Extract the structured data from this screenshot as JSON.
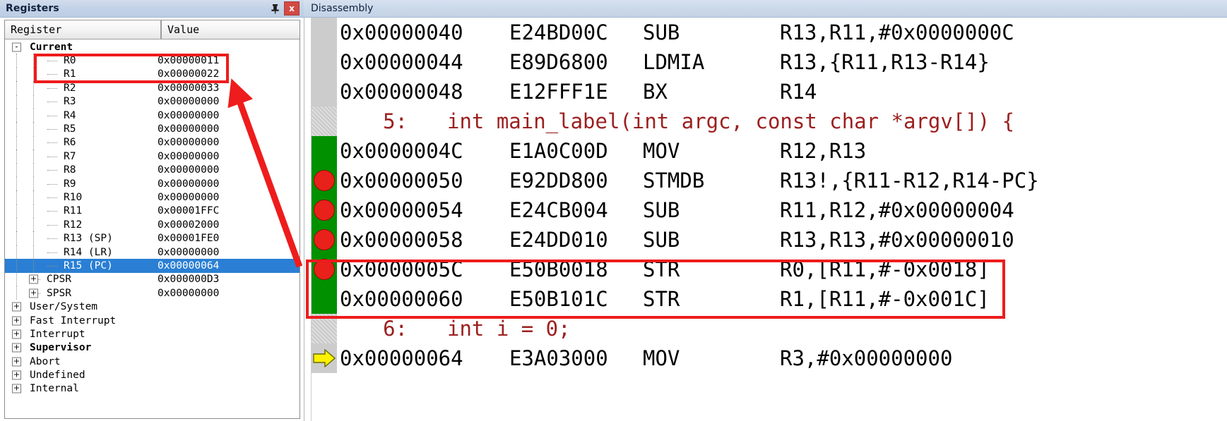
{
  "registers_panel": {
    "title": "Registers",
    "pin_icon": "pin-icon",
    "close_label": "x",
    "columns": {
      "name": "Register",
      "value": "Value"
    },
    "rows": [
      {
        "label": "Current",
        "value": "",
        "level": 0,
        "expander": "-",
        "bold": true,
        "selected": false
      },
      {
        "label": "R0",
        "value": "0x00000011",
        "level": 2,
        "expander": "",
        "bold": false,
        "selected": false
      },
      {
        "label": "R1",
        "value": "0x00000022",
        "level": 2,
        "expander": "",
        "bold": false,
        "selected": false
      },
      {
        "label": "R2",
        "value": "0x00000033",
        "level": 2,
        "expander": "",
        "bold": false,
        "selected": false
      },
      {
        "label": "R3",
        "value": "0x00000000",
        "level": 2,
        "expander": "",
        "bold": false,
        "selected": false
      },
      {
        "label": "R4",
        "value": "0x00000000",
        "level": 2,
        "expander": "",
        "bold": false,
        "selected": false
      },
      {
        "label": "R5",
        "value": "0x00000000",
        "level": 2,
        "expander": "",
        "bold": false,
        "selected": false
      },
      {
        "label": "R6",
        "value": "0x00000000",
        "level": 2,
        "expander": "",
        "bold": false,
        "selected": false
      },
      {
        "label": "R7",
        "value": "0x00000000",
        "level": 2,
        "expander": "",
        "bold": false,
        "selected": false
      },
      {
        "label": "R8",
        "value": "0x00000000",
        "level": 2,
        "expander": "",
        "bold": false,
        "selected": false
      },
      {
        "label": "R9",
        "value": "0x00000000",
        "level": 2,
        "expander": "",
        "bold": false,
        "selected": false
      },
      {
        "label": "R10",
        "value": "0x00000000",
        "level": 2,
        "expander": "",
        "bold": false,
        "selected": false
      },
      {
        "label": "R11",
        "value": "0x00001FFC",
        "level": 2,
        "expander": "",
        "bold": false,
        "selected": false
      },
      {
        "label": "R12",
        "value": "0x00002000",
        "level": 2,
        "expander": "",
        "bold": false,
        "selected": false
      },
      {
        "label": "R13 (SP)",
        "value": "0x00001FE0",
        "level": 2,
        "expander": "",
        "bold": false,
        "selected": false
      },
      {
        "label": "R14 (LR)",
        "value": "0x00000000",
        "level": 2,
        "expander": "",
        "bold": false,
        "selected": false
      },
      {
        "label": "R15 (PC)",
        "value": "0x00000064",
        "level": 2,
        "expander": "",
        "bold": false,
        "selected": true
      },
      {
        "label": "CPSR",
        "value": "0x000000D3",
        "level": 1,
        "expander": "+",
        "bold": false,
        "selected": false
      },
      {
        "label": "SPSR",
        "value": "0x00000000",
        "level": 1,
        "expander": "+",
        "bold": false,
        "selected": false
      },
      {
        "label": "User/System",
        "value": "",
        "level": 0,
        "expander": "+",
        "bold": false,
        "selected": false
      },
      {
        "label": "Fast Interrupt",
        "value": "",
        "level": 0,
        "expander": "+",
        "bold": false,
        "selected": false
      },
      {
        "label": "Interrupt",
        "value": "",
        "level": 0,
        "expander": "+",
        "bold": false,
        "selected": false
      },
      {
        "label": "Supervisor",
        "value": "",
        "level": 0,
        "expander": "+",
        "bold": true,
        "selected": false
      },
      {
        "label": "Abort",
        "value": "",
        "level": 0,
        "expander": "+",
        "bold": false,
        "selected": false
      },
      {
        "label": "Undefined",
        "value": "",
        "level": 0,
        "expander": "+",
        "bold": false,
        "selected": false
      },
      {
        "label": "Internal",
        "value": "",
        "level": 0,
        "expander": "+",
        "bold": false,
        "selected": false
      }
    ]
  },
  "disassembly_panel": {
    "title": "Disassembly",
    "rows": [
      {
        "kind": "code",
        "gutter": "plain",
        "marker": "none",
        "address": "0x00000040",
        "opcode": "E24BD00C",
        "mnemonic": "SUB",
        "operands": "R13,R11,#0x0000000C"
      },
      {
        "kind": "code",
        "gutter": "plain",
        "marker": "none",
        "address": "0x00000044",
        "opcode": "E89D6800",
        "mnemonic": "LDMIA",
        "operands": "R13,{R11,R13-R14}"
      },
      {
        "kind": "code",
        "gutter": "plain",
        "marker": "none",
        "address": "0x00000048",
        "opcode": "E12FFF1E",
        "mnemonic": "BX",
        "operands": "R14"
      },
      {
        "kind": "source",
        "gutter": "hatch",
        "line_number": "5:",
        "text": "int main_label(int argc, const char *argv[]) {"
      },
      {
        "kind": "code",
        "gutter": "green",
        "marker": "none",
        "address": "0x0000004C",
        "opcode": "E1A0C00D",
        "mnemonic": "MOV",
        "operands": "R12,R13"
      },
      {
        "kind": "code",
        "gutter": "green",
        "marker": "breakpoint",
        "address": "0x00000050",
        "opcode": "E92DD800",
        "mnemonic": "STMDB",
        "operands": "R13!,{R11-R12,R14-PC}"
      },
      {
        "kind": "code",
        "gutter": "green",
        "marker": "breakpoint",
        "address": "0x00000054",
        "opcode": "E24CB004",
        "mnemonic": "SUB",
        "operands": "R11,R12,#0x00000004"
      },
      {
        "kind": "code",
        "gutter": "green",
        "marker": "breakpoint",
        "address": "0x00000058",
        "opcode": "E24DD010",
        "mnemonic": "SUB",
        "operands": "R13,R13,#0x00000010"
      },
      {
        "kind": "code",
        "gutter": "green",
        "marker": "breakpoint",
        "address": "0x0000005C",
        "opcode": "E50B0018",
        "mnemonic": "STR",
        "operands": "R0,[R11,#-0x0018]"
      },
      {
        "kind": "code",
        "gutter": "green",
        "marker": "none",
        "address": "0x00000060",
        "opcode": "E50B101C",
        "mnemonic": "STR",
        "operands": "R1,[R11,#-0x001C]"
      },
      {
        "kind": "source",
        "gutter": "hatch",
        "line_number": "6:",
        "text": "int i = 0;"
      },
      {
        "kind": "code",
        "gutter": "plain",
        "marker": "pc",
        "address": "0x00000064",
        "opcode": "E3A03000",
        "mnemonic": "MOV",
        "operands": "R3,#0x00000000"
      }
    ]
  },
  "annotations": {
    "register_highlight_box": "red-rectangle-around-r0-r1",
    "code_highlight_box": "red-rectangle-around-str-instructions",
    "arrow": "red-arrow-from-str-rows-to-r0-r1",
    "color": "#EE1C1C"
  },
  "theme": {
    "selection_blue": "#2A7FD4",
    "breakpoint_red": "#E8211A",
    "executed_green": "#009000",
    "source_text_red": "#9C1F1F",
    "pc_arrow_yellow": "#FFF200",
    "annotation_red": "#EE1C1C"
  }
}
